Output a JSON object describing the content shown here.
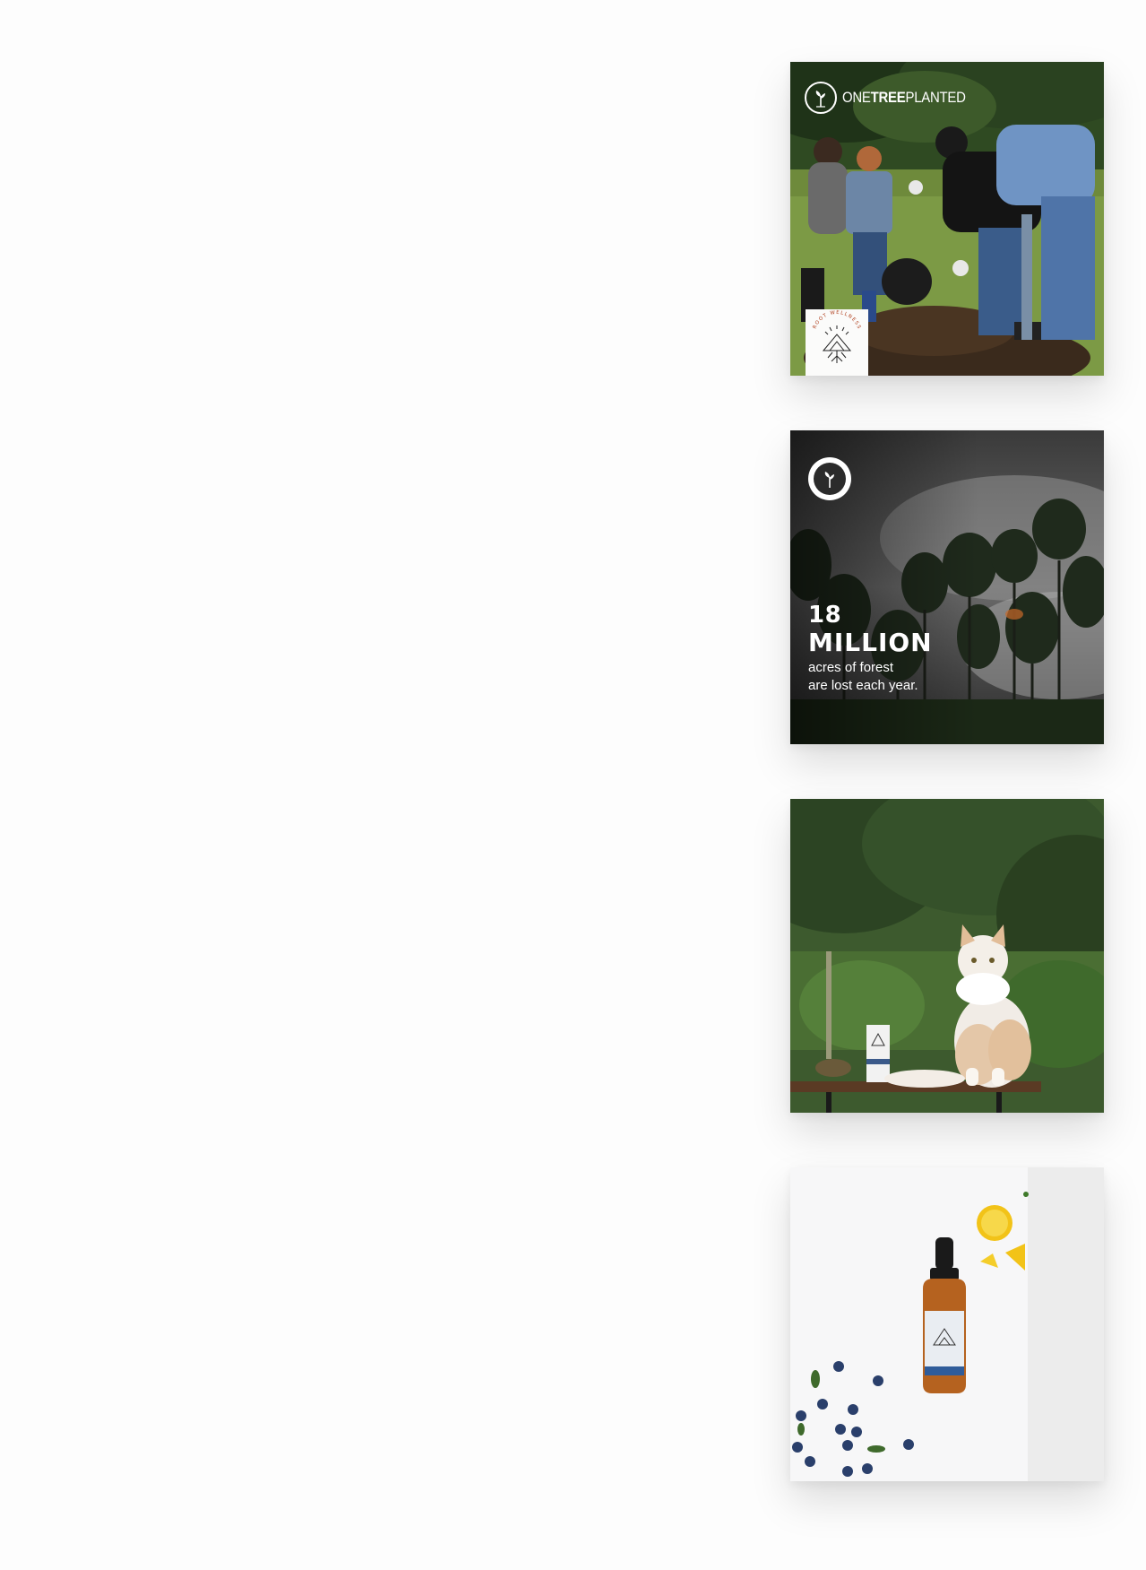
{
  "feed": {
    "posts": [
      {
        "kind": "photo",
        "subject": "people planting a tree",
        "partner_logo": {
          "icon": "sapling-icon",
          "text_regular_1": "ONE",
          "text_bold": "TREE",
          "text_regular_2": "PLANTED"
        },
        "brand_badge": {
          "icon": "root-wellness-logo-icon",
          "text": "ROOT WELLNESS"
        }
      },
      {
        "kind": "stat-card",
        "seal_icon": "onetreeplanted-seal-icon",
        "stat_number": "18",
        "stat_unit": "MILLION",
        "caption_line_1": "acres of forest",
        "caption_line_2": "are lost each year."
      },
      {
        "kind": "photo",
        "subject": "cat sitting on a bench next to product box"
      },
      {
        "kind": "photo",
        "subject": "tincture bottle with blueberries and lemon slices"
      }
    ]
  },
  "colors": {
    "page_bg": "#fdfdfd",
    "stat_text": "#ffffff",
    "grass": "#6e8a3b",
    "foliage": "#2f4a22",
    "smoke": "#8c8c8c",
    "blueberry": "#2a3f6b",
    "lemon": "#f2c318",
    "bottle_amber": "#b5621f"
  }
}
